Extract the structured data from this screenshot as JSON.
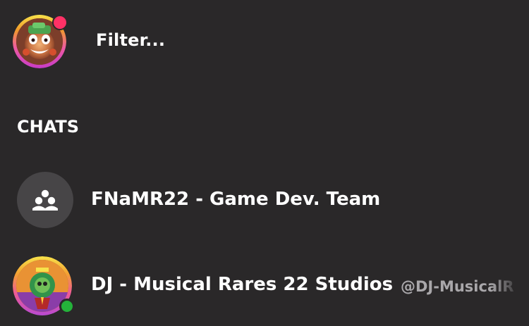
{
  "colors": {
    "background": "#2a2829",
    "text_primary": "#ffffff",
    "text_secondary": "#a9a7aa",
    "notification": "#ff3166",
    "online": "#24b23a",
    "group_avatar_bg": "#474547"
  },
  "header": {
    "avatar_icon": "profile-avatar-icon",
    "filter_text": "Filter..."
  },
  "chats": {
    "section_title": "CHATS",
    "items": [
      {
        "type": "group",
        "name": "FNaMR22 - Game Dev. Team",
        "icon": "group-icon"
      },
      {
        "type": "dm",
        "name": "DJ - Musical Rares 22 Studios",
        "handle": "@DJ-MusicalR",
        "avatar_icon": "dj-avatar-icon",
        "status": "online"
      }
    ]
  }
}
